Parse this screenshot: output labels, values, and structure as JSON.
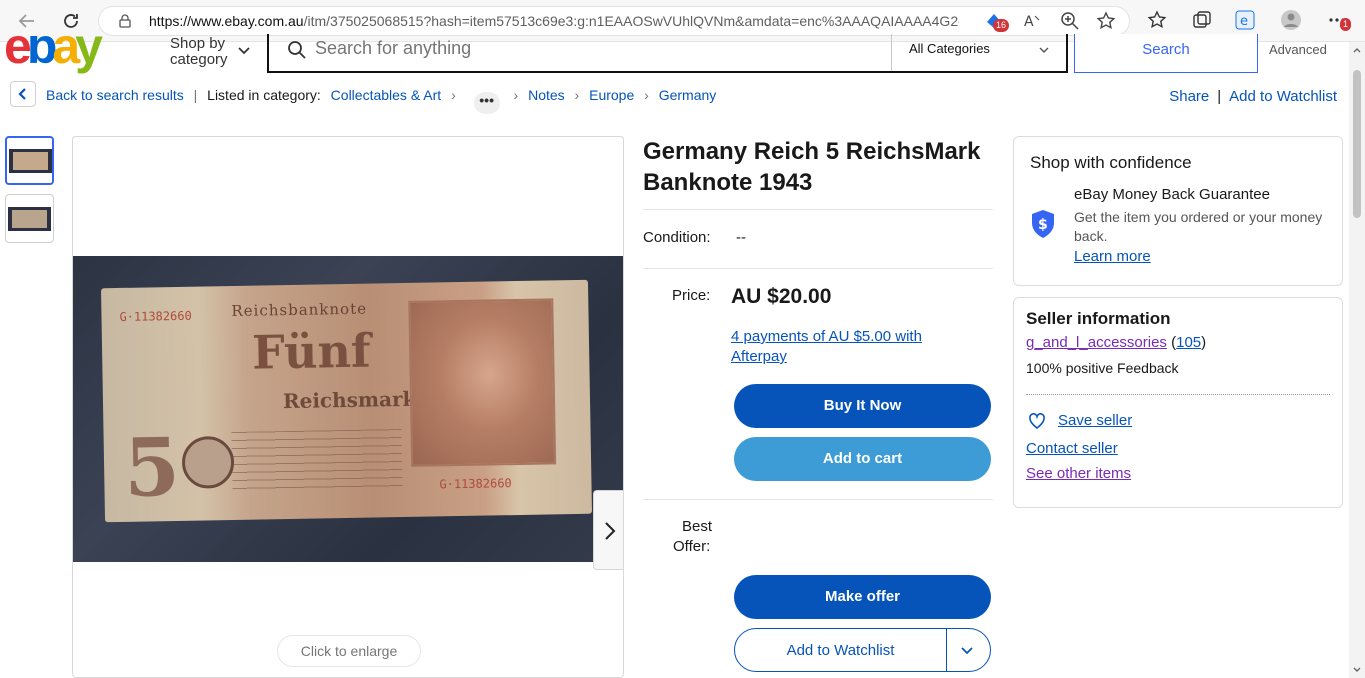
{
  "browser": {
    "url_domain": "https://www.ebay.com.au",
    "url_rest": "/itm/375025068515?hash=item57513c69e3:g:n1EAAOSwVUhlQVNm&amdata=enc%3AAAQAIAAAA4G2cx...",
    "extension_badge": "16",
    "notifications_badge": "1"
  },
  "header": {
    "logo": "ebay",
    "logo_colors": [
      "#e53238",
      "#0064d2",
      "#f5af02",
      "#86b817"
    ],
    "shop_by_category_line1": "Shop by",
    "shop_by_category_line2": "category",
    "search_placeholder": "Search for anything",
    "category_select": "All Categories",
    "search_button": "Search",
    "advanced_link": "Advanced"
  },
  "breadcrumb": {
    "back": "Back to search results",
    "listed_in": "Listed in category:",
    "items": [
      "Collectables & Art",
      "Notes",
      "Europe",
      "Germany"
    ],
    "more": "•••",
    "share": "Share",
    "add_to_watchlist": "Add to Watchlist"
  },
  "gallery": {
    "enlarge": "Click to enlarge",
    "banknote_title": "Reichsbanknote",
    "banknote_big": "Fünf",
    "banknote_word": "Reichsmark",
    "banknote_digit": "5",
    "serial": "G·11382660"
  },
  "item": {
    "title": "Germany Reich 5 ReichsMark Banknote 1943",
    "condition_label": "Condition:",
    "condition_value": "--",
    "price_label": "Price:",
    "price": "AU $20.00",
    "afterpay": "4 payments of AU $5.00 with Afterpay",
    "buy_now": "Buy It Now",
    "add_to_cart": "Add to cart",
    "best_offer_label_1": "Best",
    "best_offer_label_2": "Offer:",
    "make_offer": "Make offer",
    "add_to_watchlist": "Add to Watchlist"
  },
  "confidence": {
    "title": "Shop with confidence",
    "guarantee_title": "eBay Money Back Guarantee",
    "guarantee_desc": "Get the item you ordered or your money back.",
    "learn_more": "Learn more"
  },
  "seller": {
    "title": "Seller information",
    "name": "g_and_l_accessories",
    "feedback_count": "105",
    "positive": "100% positive Feedback",
    "save_seller": "Save seller",
    "contact": "Contact seller",
    "other_items": "See other items"
  }
}
